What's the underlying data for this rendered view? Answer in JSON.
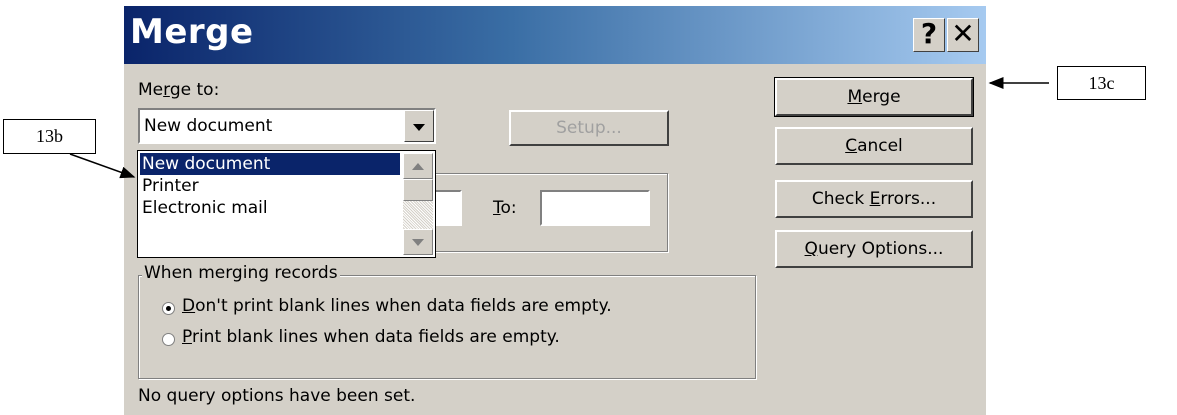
{
  "dialog": {
    "title": "Merge",
    "help_button": "?",
    "close_button": "✕",
    "merge_to_label_pre": "Me",
    "merge_to_label_u": "r",
    "merge_to_label_post": "ge to:",
    "merge_to_selected": "New document",
    "merge_to_options": [
      "New document",
      "Printer",
      "Electronic mail"
    ],
    "setup_button": "Setup...",
    "to_label_u": "T",
    "to_label_post": "o:",
    "to_value": "",
    "buttons": {
      "merge_u": "M",
      "merge_post": "erge",
      "cancel_u": "C",
      "cancel_post": "ancel",
      "check_pre": "Check ",
      "check_u": "E",
      "check_post": "rrors...",
      "query_u": "Q",
      "query_post": "uery Options..."
    },
    "records_group_label": "When merging records",
    "option1_u": "D",
    "option1_post": "on't print blank lines when data fields are empty.",
    "option2_u": "P",
    "option2_post": "rint blank lines when data fields are empty.",
    "selected_option": "Don't print blank lines when data fields are empty.",
    "status_text": "No query options have been set."
  },
  "annotations": {
    "callout_b": "13b",
    "callout_c": "13c"
  },
  "colors": {
    "title_start": "#0a246a",
    "title_end": "#a6caf0",
    "face": "#d4d0c8",
    "selection": "#0a246a"
  }
}
